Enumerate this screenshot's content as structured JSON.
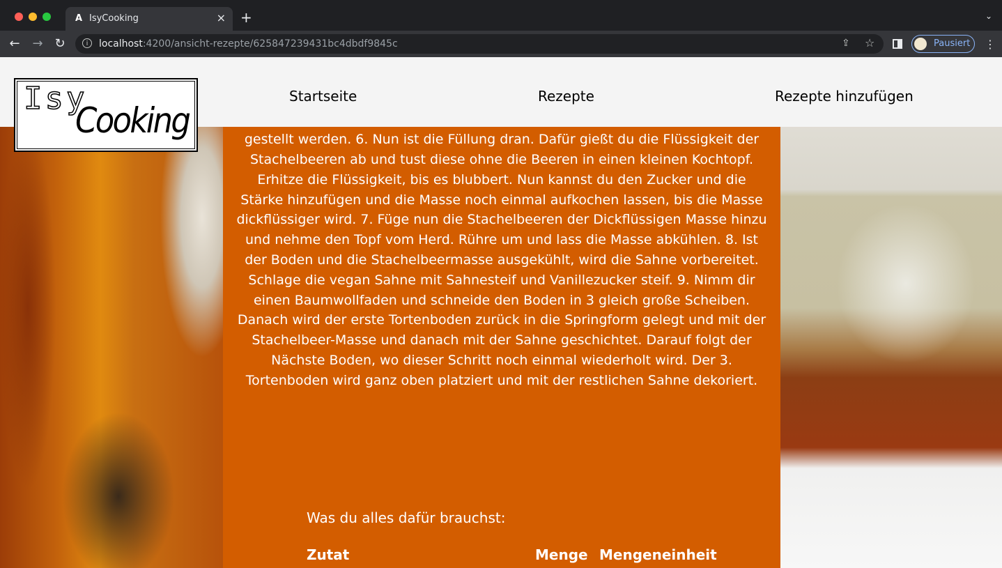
{
  "browser": {
    "tab_title": "IsyCooking",
    "url_host": "localhost",
    "url_rest": ":4200/ansicht-rezepte/625847239431bc4dbdf9845c",
    "profile_label": "Pausiert",
    "icons": [
      "info-icon",
      "share-icon",
      "star-icon",
      "sidepanel-icon",
      "kebab-icon"
    ]
  },
  "nav": {
    "logo_isy": "Isy",
    "logo_cooking": "Cooking",
    "links": [
      "Startseite",
      "Rezepte",
      "Rezepte hinzufügen"
    ]
  },
  "recipe": {
    "instructions": "trockenen Zutaten hinzufügen und wieder per Hand verrühren. 4. Gieße den Teig in die vorbereitete Springform, streue Mandeln drüber und backe den Boden für 30 Minuten. 5. Mache den Stäbchen-Test. Wenn das Stäbchen kein Teig mehr haften hat, ist der Boden fertig und kann zum auskühlen Beiseite gestellt werden. 6. Nun ist die Füllung dran. Dafür gießt du die Flüssigkeit der Stachelbeeren ab und tust diese ohne die Beeren in einen kleinen Kochtopf. Erhitze die Flüssigkeit, bis es blubbert. Nun kannst du den Zucker und die Stärke hinzufügen und die Masse noch einmal aufkochen lassen, bis die Masse dickflüssiger wird. 7. Füge nun die Stachelbeeren der Dickflüssigen Masse hinzu und nehme den Topf vom Herd. Rühre um und lass die Masse abkühlen. 8. Ist der Boden und die Stachelbeermasse ausgekühlt, wird die Sahne vorbereitet. Schlage die vegan Sahne mit Sahnesteif und Vanillezucker steif. 9. Nimm dir einen Baumwollfaden und schneide den Boden in 3 gleich große Scheiben. Danach wird der erste Tortenboden zurück in die Springform gelegt und mit der Stachelbeer-Masse und danach mit der Sahne geschichtet. Darauf folgt der Nächste Boden, wo dieser Schritt noch einmal wiederholt wird. Der 3. Tortenboden wird ganz oben platziert und mit der restlichen Sahne dekoriert.",
    "needs_heading": "Was du alles dafür brauchst:",
    "table_headers": [
      "Zutat",
      "Menge",
      "Mengeneinheit"
    ]
  },
  "colors": {
    "content_bg": "#d35d00",
    "navbar_bg": "#f4f4f4"
  }
}
